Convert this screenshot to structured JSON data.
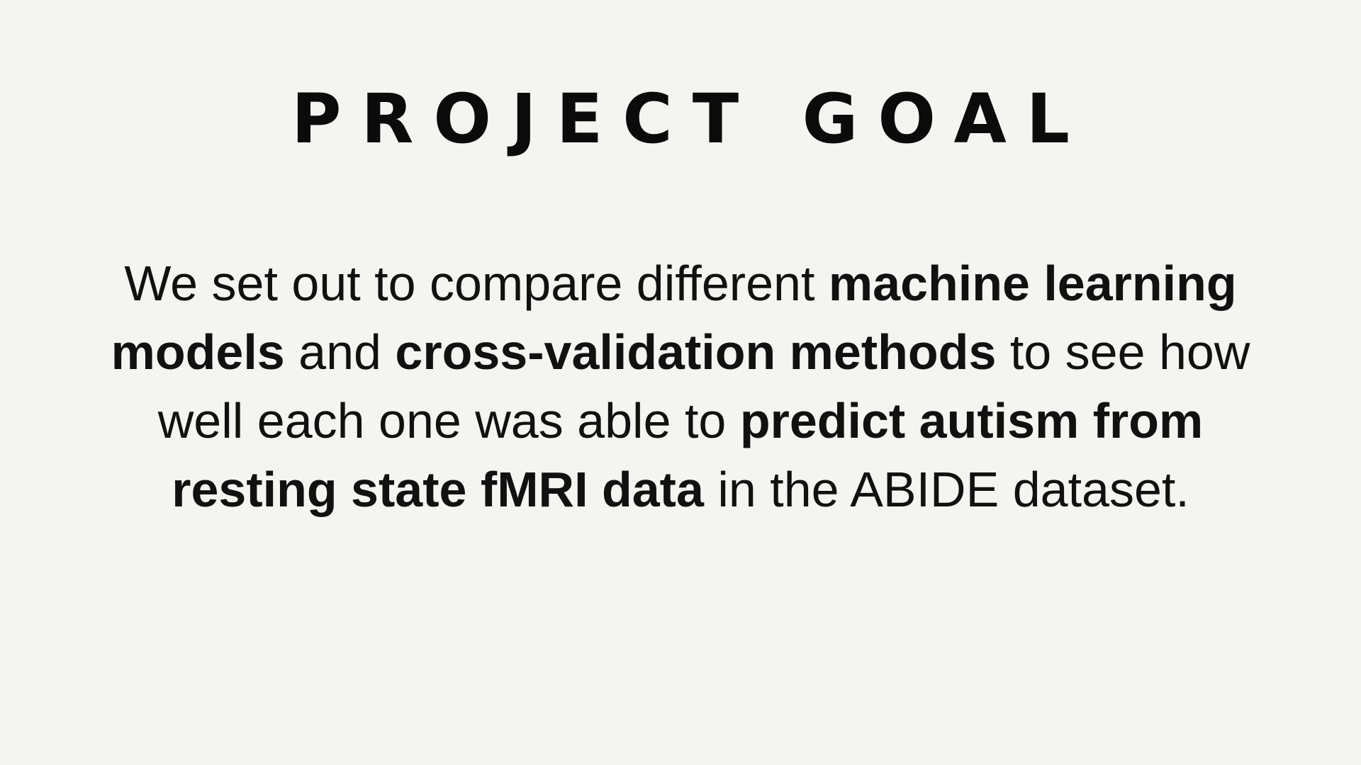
{
  "slide": {
    "title": "PROJECT GOAL",
    "body": {
      "t1": "We set out to compare different ",
      "b1": "machine learning models",
      "t2": " and ",
      "b2": "cross-validation methods",
      "t3": " to see how well each one was able to ",
      "b3": "predict autism from resting state fMRI data",
      "t4": " in the ABIDE dataset."
    }
  },
  "colors": {
    "background": "#f4f4f0",
    "text": "#0b0b0b"
  }
}
